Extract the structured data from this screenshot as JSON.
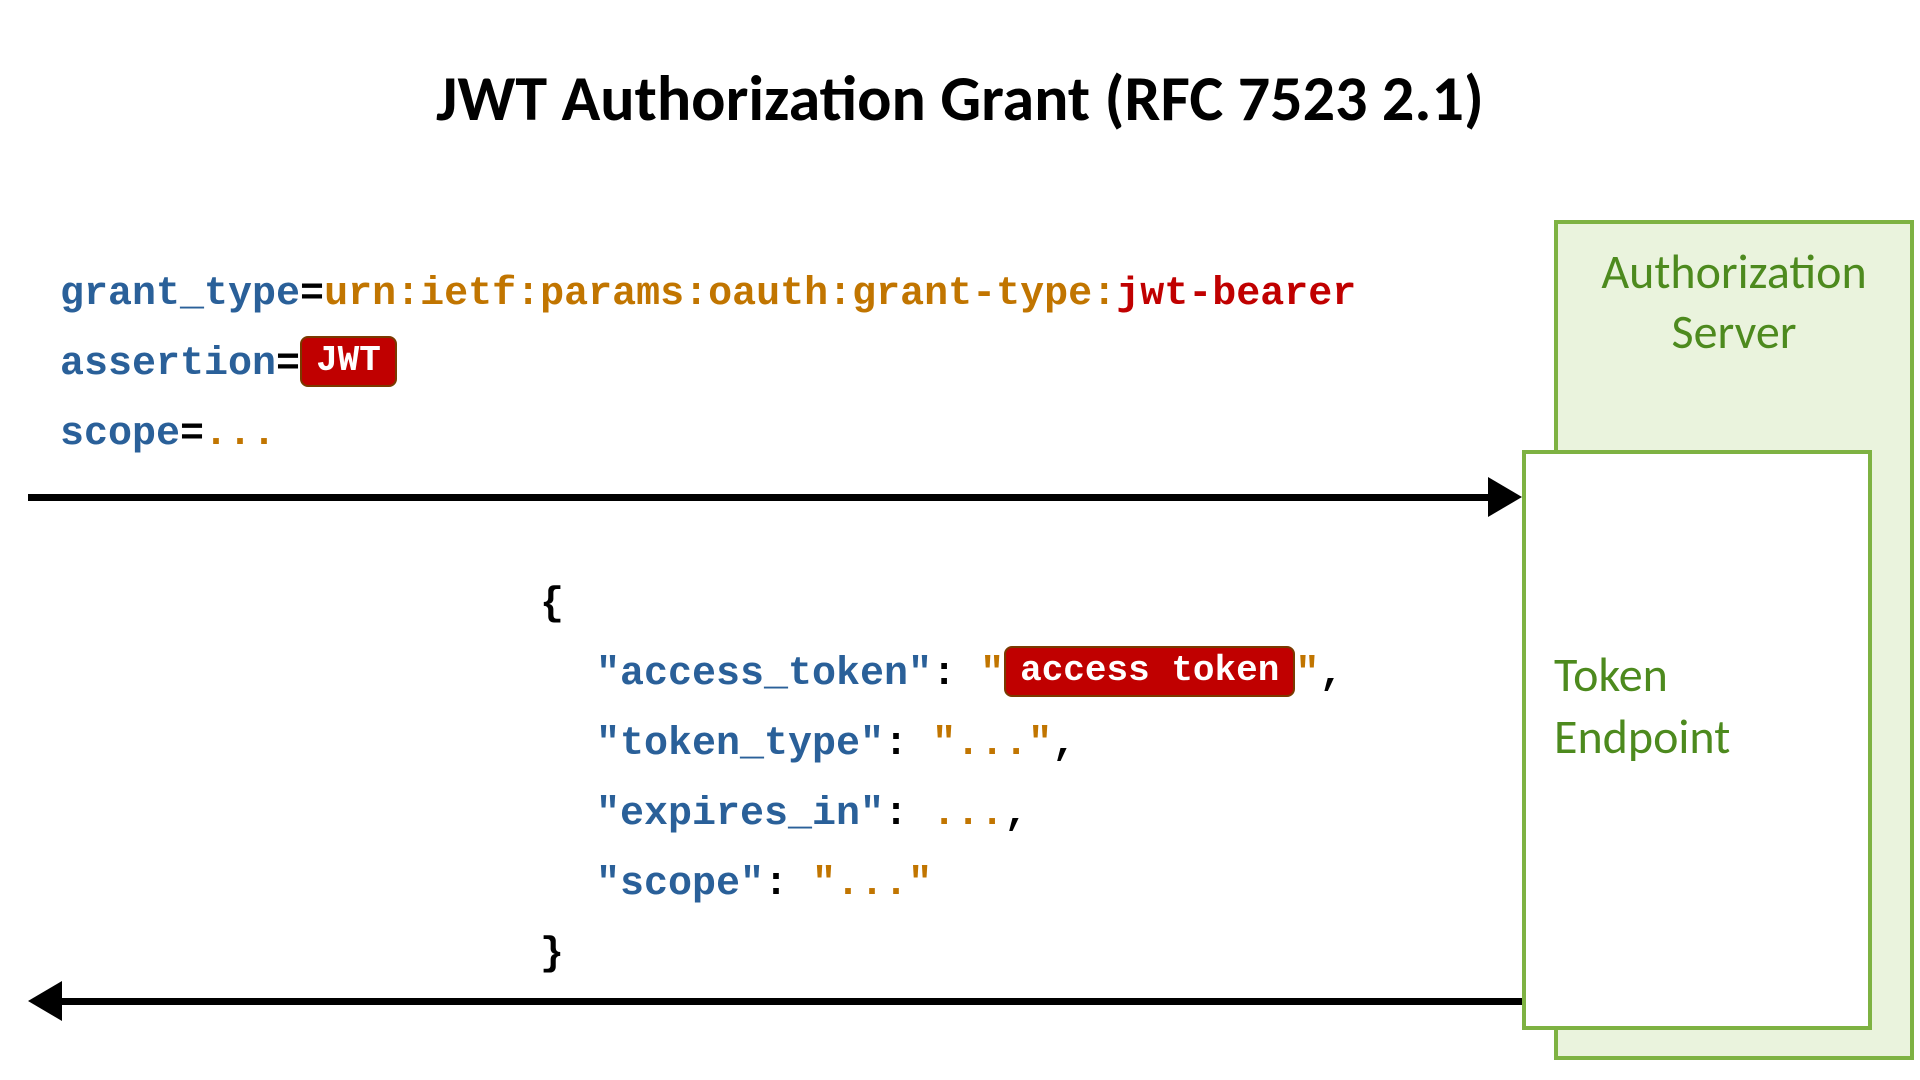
{
  "title": "JWT Authorization Grant (RFC 7523 2.1)",
  "server": {
    "auth_label_l1": "Authorization",
    "auth_label_l2": "Server",
    "endpoint_l1": "Token",
    "endpoint_l2": "Endpoint"
  },
  "request": {
    "param1_key": "grant_type",
    "param1_prefix": "urn:ietf:params:oauth:grant-type:",
    "param1_suffix": "jwt-bearer",
    "param2_key": "assertion",
    "param2_badge": "JWT",
    "param3_key": "scope",
    "param3_value": "...",
    "eq": "="
  },
  "response": {
    "brace_open": "{",
    "brace_close": "}",
    "k_access": "\"access_token\"",
    "v_access_q1": "\"",
    "v_access_badge": "access token",
    "v_access_q2": "\"",
    "k_type": "\"token_type\"",
    "v_type": "\"...\"",
    "k_exp": "\"expires_in\"",
    "v_exp": "...",
    "k_scope": "\"scope\"",
    "v_scope": "\"...\"",
    "colon": ": ",
    "comma": ","
  }
}
